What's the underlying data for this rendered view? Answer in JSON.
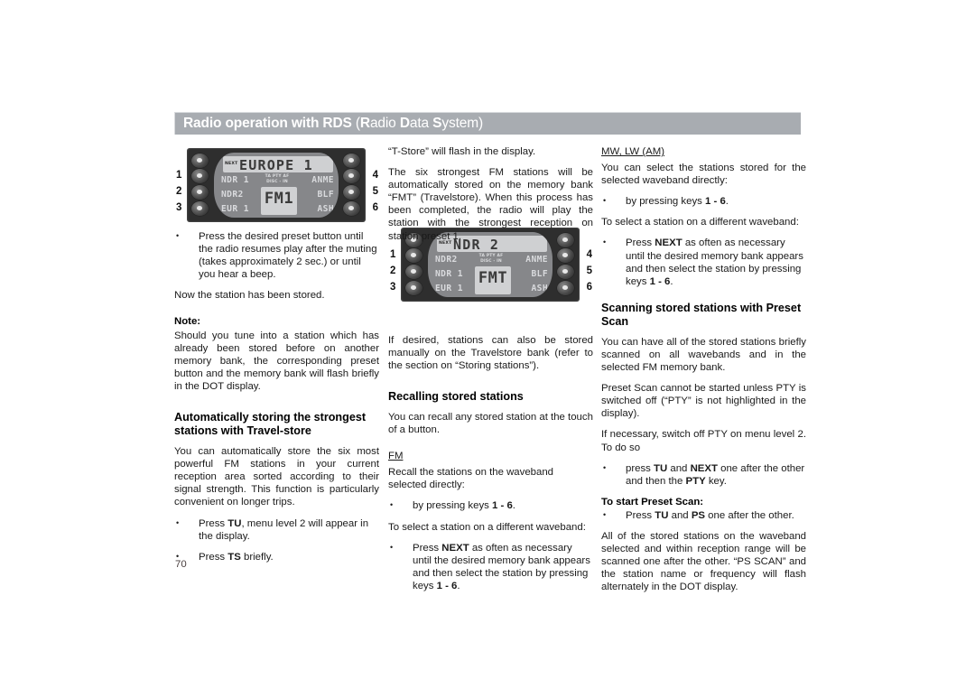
{
  "header": {
    "title_main": "Radio operation with RDS",
    "title_paren_open": "(",
    "title_words": [
      "Radio",
      "Data",
      "System"
    ],
    "title_paren_close": ")",
    "bar_color": "#a8acb1"
  },
  "page_number": "70",
  "figures": {
    "figure_1": {
      "next_label": "NEXT",
      "display_main": "EUROPE 1",
      "left_presets": [
        "NDR 1",
        "NDR2",
        "EUR 1"
      ],
      "right_presets": [
        "ANME",
        "BLF",
        "ASH"
      ],
      "indicator_line_1": "TA PTY AF",
      "indicator_line_2": "DISC - IN",
      "band": "FM1",
      "left_numbers": [
        "1",
        "2",
        "3"
      ],
      "right_numbers": [
        "4",
        "5",
        "6"
      ]
    },
    "figure_2": {
      "next_label": "NEXT",
      "display_main": "NDR 2",
      "left_presets": [
        "NDR2",
        "NDR 1",
        "EUR 1"
      ],
      "right_presets": [
        "ANME",
        "BLF",
        "ASH"
      ],
      "indicator_line_1": "TA PTY AF",
      "indicator_line_2": "DISC - IN",
      "band": "FMT",
      "left_numbers": [
        "1",
        "2",
        "3"
      ],
      "right_numbers": [
        "4",
        "5",
        "6"
      ]
    }
  },
  "column_1": {
    "bullet_press_preset": "Press the desired preset button until the radio resumes play after the muting (takes approximately 2 sec.) or until you hear a beep.",
    "stored_confirmation": "Now the station has been stored.",
    "note_label": "Note:",
    "note_text": "Should you tune into a station which has already been stored before on another memory bank, the corresponding preset button and the memory bank will flash briefly in the DOT display.",
    "heading_travelstore": "Automatically storing the strongest stations with Travel-store",
    "travelstore_intro": "You can automatically store the six most powerful FM stations in your current reception area sorted according to their signal strength. This function is particularly convenient on longer trips.",
    "bullet_tu_pre": "Press ",
    "bullet_tu_key": "TU",
    "bullet_tu_post": ", menu level 2 will appear in the display.",
    "bullet_ts_pre": "Press ",
    "bullet_ts_key": "TS",
    "bullet_ts_post": " briefly."
  },
  "column_2": {
    "tstore_flash": "“T-Store” will flash in the display.",
    "six_strongest": "The six strongest FM stations will be automatically stored on the memory bank “FMT” (Travelstore). When this process has been completed, the radio will play the station with the strongest reception on station preset 1.",
    "manual_store": "If desired, stations can also be stored manually on the Travelstore bank (refer to the section on “Storing stations”).",
    "heading_recalling": "Recalling stored stations",
    "recall_intro": "You can recall any stored station at the touch of a button.",
    "subhead_fm": "FM",
    "fm_recall": "Recall the stations on the waveband selected directly:",
    "bullet_keys_pre": "by pressing keys ",
    "bullet_keys_key": "1 - 6",
    "bullet_keys_post": ".",
    "different_waveband": "To select a station on a different waveband:",
    "bullet_next_pre": "Press ",
    "bullet_next_key": "NEXT",
    "bullet_next_mid": " as often as necessary until the desired memory bank appears and then select the station by pressing keys ",
    "bullet_next_key2": "1 - 6",
    "bullet_next_post": "."
  },
  "column_3": {
    "subhead_mwlw": "MW, LW (AM)",
    "mwlw_intro": "You can select the stations stored for the selected waveband directly:",
    "bullet_keys_pre": "by pressing keys ",
    "bullet_keys_key": "1 - 6",
    "bullet_keys_post": ".",
    "different_waveband": "To select a station on a different waveband:",
    "bullet_next_pre": "Press ",
    "bullet_next_key": "NEXT",
    "bullet_next_mid": " as often as necessary until the desired memory bank appears and then select the station by pressing keys ",
    "bullet_next_key2": "1 - 6",
    "bullet_next_post": ".",
    "heading_preset_scan": "Scanning stored stations with Preset Scan",
    "scan_intro": "You can have all of the stored stations briefly scanned on all wavebands and in the selected FM memory bank.",
    "scan_pty": "Preset Scan cannot be started unless PTY is switched off (“PTY” is not highlighted in the display).",
    "scan_menu": "If necessary, switch off PTY on menu level 2. To do so",
    "bullet_pty_pre": "press ",
    "bullet_pty_key1": "TU",
    "bullet_pty_mid": " and ",
    "bullet_pty_key2": "NEXT",
    "bullet_pty_mid2": " one after the other and then the ",
    "bullet_pty_key3": "PTY",
    "bullet_pty_post": " key.",
    "start_scan_label": "To start Preset Scan:",
    "bullet_start_pre": "Press ",
    "bullet_start_key1": "TU",
    "bullet_start_mid": " and ",
    "bullet_start_key2": "PS",
    "bullet_start_post": " one after the other.",
    "scan_outro": "All of the stored stations on the waveband selected and within reception range will be scanned one after the other. “PS SCAN” and the station name or frequency will flash alternately in the DOT display."
  }
}
